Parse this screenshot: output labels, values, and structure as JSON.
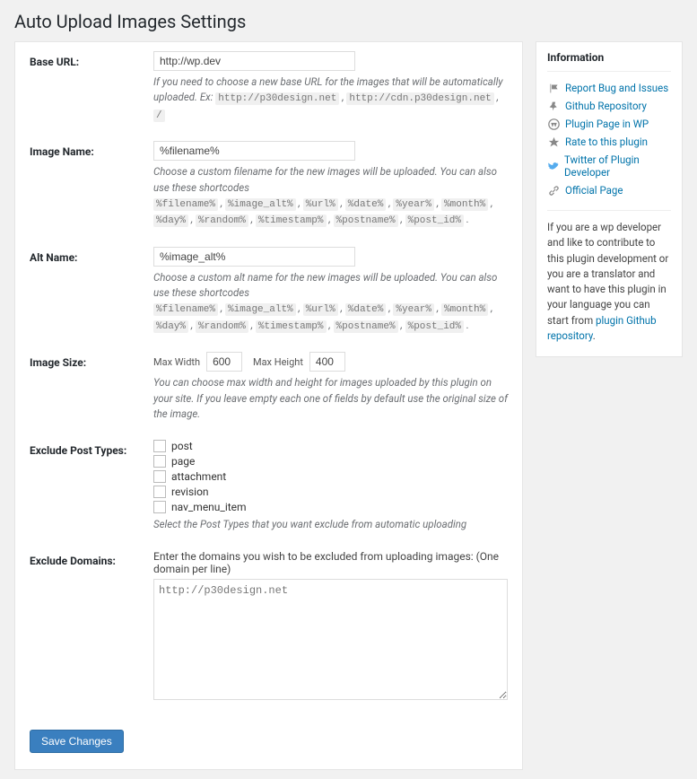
{
  "page_title": "Auto Upload Images Settings",
  "base_url": {
    "label": "Base URL:",
    "value": "http://wp.dev",
    "desc_prefix": "If you need to choose a new base URL for the images that will be automatically uploaded. Ex:",
    "ex1": "http://p30design.net",
    "ex2": "http://cdn.p30design.net",
    "ex3": "/",
    "sep": ", "
  },
  "image_name": {
    "label": "Image Name:",
    "value": "%filename%",
    "desc": "Choose a custom filename for the new images will be uploaded. You can also use these shortcodes"
  },
  "alt_name": {
    "label": "Alt Name:",
    "value": "%image_alt%",
    "desc": "Choose a custom alt name for the new images will be uploaded. You can also use these shortcodes"
  },
  "shortcodes": [
    "%filename%",
    "%image_alt%",
    "%url%",
    "%date%",
    "%year%",
    "%month%",
    "%day%",
    "%random%",
    "%timestamp%",
    "%postname%",
    "%post_id%"
  ],
  "image_size": {
    "label": "Image Size:",
    "max_width_label": "Max Width",
    "max_width": "600",
    "max_height_label": "Max Height",
    "max_height": "400",
    "desc": "You can choose max width and height for images uploaded by this plugin on your site. If you leave empty each one of fields by default use the original size of the image."
  },
  "exclude_post_types": {
    "label": "Exclude Post Types:",
    "options": [
      "post",
      "page",
      "attachment",
      "revision",
      "nav_menu_item"
    ],
    "desc": "Select the Post Types that you want exclude from automatic uploading"
  },
  "exclude_domains": {
    "label": "Exclude Domains:",
    "desc": "Enter the domains you wish to be excluded from uploading images: (One domain per line)",
    "value": "http://p30design.net"
  },
  "save_button": "Save Changes",
  "sidebar": {
    "title": "Information",
    "links": [
      {
        "label": "Report Bug and Issues"
      },
      {
        "label": "Github Repository"
      },
      {
        "label": "Plugin Page in WP"
      },
      {
        "label": "Rate to this plugin"
      },
      {
        "label": "Twitter of Plugin Developer"
      },
      {
        "label": "Official Page"
      }
    ],
    "footer_text": "If you are a wp developer and like to contribute to this plugin development or you are a translator and want to have this plugin in your language you can start from ",
    "footer_link": "plugin Github repository",
    "footer_after": "."
  }
}
